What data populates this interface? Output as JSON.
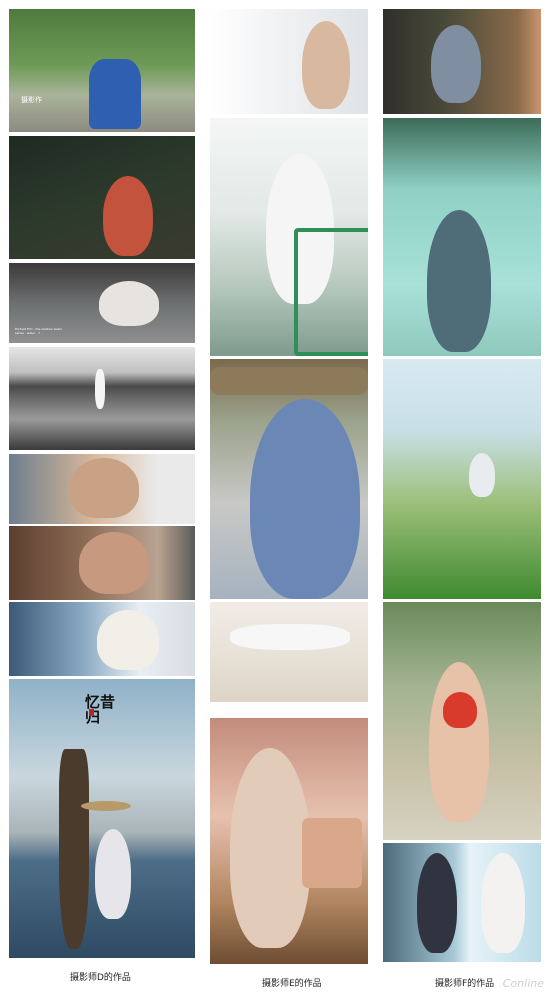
{
  "captions": {
    "col1": "摄影师D的作品",
    "col2": "摄影师E的作品",
    "col3": "摄影师F的作品"
  },
  "overlays": {
    "photo1_watermark": "摄影作",
    "photo3_text": "Portrait film · the shallow water series · water · 7"
  },
  "poster_title": "忆昔归",
  "site_watermark": "Conline"
}
